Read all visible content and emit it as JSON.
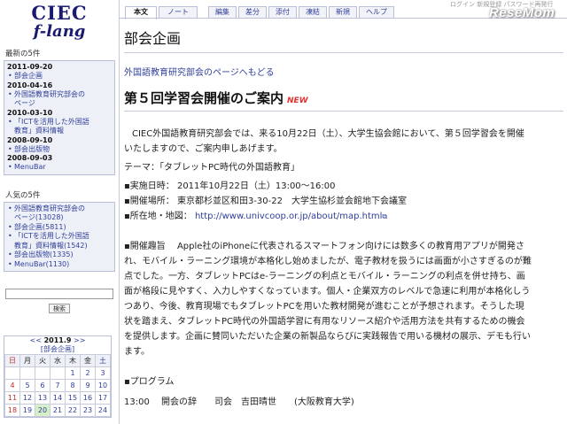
{
  "logo": {
    "top": "CIEC",
    "sub": "f-lang"
  },
  "brand": "ReseMom",
  "toplinks": "ログイン 新規登録 パスワード再発行",
  "sidebar": {
    "latest_heading": "最新の5件",
    "latest": [
      {
        "date": "2011-09-20",
        "items": [
          "部会企画"
        ]
      },
      {
        "date": "2010-04-16",
        "items": [
          "外国語教育研究部会の",
          "ページ"
        ]
      },
      {
        "date": "2010-03-10",
        "items": [
          "「ICTを活用した外国語",
          "教育」資料情報"
        ]
      },
      {
        "date": "2008-09-10",
        "items": [
          "部会出版物"
        ]
      },
      {
        "date": "2008-09-03",
        "items": [
          "MenuBar"
        ]
      }
    ],
    "popular_heading": "人気の5件",
    "popular": [
      [
        "外国語教育研究部会の",
        "ページ(13028)"
      ],
      [
        "部会企画(5811)"
      ],
      [
        "「ICTを活用した外国語",
        "教育」資料情報(1542)"
      ],
      [
        "部会出版物(1335)"
      ],
      [
        "MenuBar(1130)"
      ]
    ],
    "search_button": "検索"
  },
  "calendar": {
    "prev": "<<",
    "month": "2011.9",
    "next": ">>",
    "page": "[部会企画]",
    "weekdays": [
      "日",
      "月",
      "火",
      "水",
      "木",
      "金",
      "土"
    ],
    "rows": [
      [
        "",
        "",
        "",
        "",
        "1",
        "2",
        "3"
      ],
      [
        "4",
        "5",
        "6",
        "7",
        "8",
        "9",
        "10"
      ],
      [
        "11",
        "12",
        "13",
        "14",
        "15",
        "16",
        "17"
      ],
      [
        "18",
        "19",
        "20",
        "21",
        "22",
        "23",
        "24"
      ]
    ],
    "today": "20"
  },
  "tabs": [
    "本文",
    "ノート",
    "編集",
    "差分",
    "添付",
    "凍結",
    "新規",
    "ヘルプ"
  ],
  "main": {
    "page_title": "部会企画",
    "backlink": "外国語教育研究部会のページへもどる",
    "heading": "第５回学習会開催のご案内",
    "new_badge": "NEW",
    "intro_line1": "CIEC外国語教育研究部会では、来る10月22日（土）、大学生協会館において、第５回学習会を開催",
    "intro_line2": "いたしますので、ご案内申しあげます。",
    "theme": "テーマ：「タブレットPC時代の外国語教育」",
    "date_line": "▪実施日時： 2011年10月22日（土）13:00〜16:00",
    "place_line": "▪開催場所： 東京都杉並区和田3-30-22　大学生協杉並会館地下会議室",
    "map_label": "▪所在地・地図：",
    "map_url": "http://www.univcoop.or.jp/about/map.html",
    "purpose": [
      "▪開催趣旨　 Apple社のiPhoneに代表されるスマートフォン向けには数多くの教育用アプリが開発さ",
      "れ、モバイル・ラーニング環境が本格化し始めましたが、電子教材を扱うには画面が小さすぎるのが難",
      "点でした。一方、タブレットPCはe-ラーニングの利点とモバイル・ラーニングの利点を併せ持ち、画",
      "面が格段に見やすく、入力しやすくなっています。個人・企業双方のレベルで急速に利用が本格化しう",
      "つあり、今後、教育現場でもタブレットPCを用いた教材開発が進むことが予想されます。そうした現",
      "状を踏まえ、タブレットPC時代の外国語学習に有用なリソース紹介や活用方法を共有するための機会",
      "を提供します。企画に賛同いただいた企業の新製品ならびに実践報告で用いる機材の展示、デモも行い",
      "ます。"
    ],
    "program_heading": "▪プログラム",
    "program_line": "13:00　 開会の辞　　司会　吉田晴世　　(大阪教育大学)"
  }
}
